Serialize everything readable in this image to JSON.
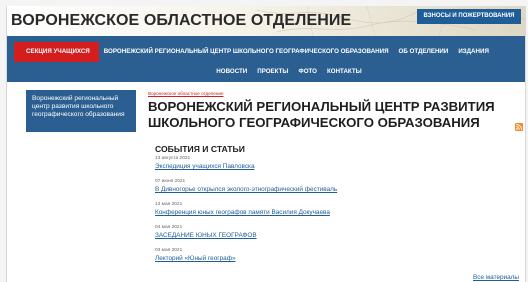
{
  "header": {
    "site_title": "ВОРОНЕЖСКОЕ ОБЛАСТНОЕ ОТДЕЛЕНИЕ",
    "donate_label": "ВЗНОСЫ И ПОЖЕРТВОВАНИЯ"
  },
  "nav": {
    "row1": [
      {
        "label": "СЕКЦИЯ УЧАЩИХСЯ",
        "active": true
      },
      {
        "label": "ВОРОНЕЖСКИЙ РЕГИОНАЛЬНЫЙ ЦЕНТР ШКОЛЬНОГО ГЕОГРАФИЧЕСКОГО ОБРАЗОВАНИЯ",
        "active": false
      },
      {
        "label": "ОБ ОТДЕЛЕНИИ",
        "active": false
      },
      {
        "label": "ИЗДАНИЯ",
        "active": false
      }
    ],
    "row2": [
      {
        "label": "НОВОСТИ"
      },
      {
        "label": "ПРОЕКТЫ"
      },
      {
        "label": "ФОТО"
      },
      {
        "label": "КОНТАКТЫ"
      }
    ]
  },
  "sidebar": {
    "active_item": "Воронежский региональный центр развития школьного географического образования"
  },
  "main": {
    "breadcrumb": "Воронежское областное отделение",
    "title": "ВОРОНЕЖСКИЙ РЕГИОНАЛЬНЫЙ ЦЕНТР РАЗВИТИЯ ШКОЛЬНОГО ГЕОГРАФИЧЕСКОГО ОБРАЗОВАНИЯ",
    "rss_icon": "rss-icon",
    "section_heading": "СОБЫТИЯ И СТАТЬИ",
    "articles": [
      {
        "date": "13 августа 2021",
        "title": "Экспедиция учащихся Павловска"
      },
      {
        "date": "07 июня 2021",
        "title": "В Дивногорье открылся эколого-этнографический фестиваль"
      },
      {
        "date": "13 мая 2021",
        "title": "Конференция юных географов памяти Василия Докучаева"
      },
      {
        "date": "04 мая 2021",
        "title": "ЗАСЕДАНИЕ ЮНЫХ ГЕОГРАФОВ"
      },
      {
        "date": "03 мая 2021",
        "title": "Лекторий «Юный географ»"
      }
    ],
    "all_materials_label": "Все материалы"
  },
  "colors": {
    "nav_bg": "#2c5f91",
    "active_red": "#d41e1e",
    "link_blue": "#1f5d99",
    "rss_orange": "#f28c28"
  }
}
